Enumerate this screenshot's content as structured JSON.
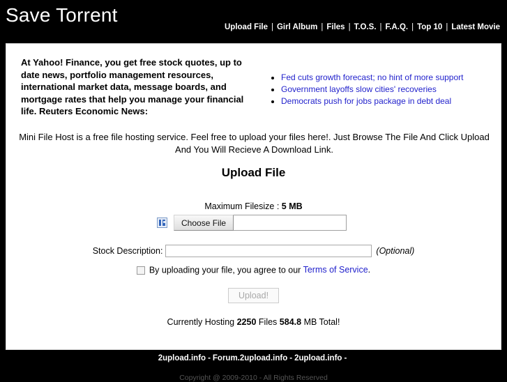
{
  "header": {
    "site_title": "Save Torrent",
    "nav": [
      {
        "label": "Upload File"
      },
      {
        "label": "Girl Album"
      },
      {
        "label": "Files"
      },
      {
        "label": "T.O.S."
      },
      {
        "label": "F.A.Q."
      },
      {
        "label": "Top 10"
      },
      {
        "label": "Latest Movie"
      }
    ],
    "nav_separator": "|"
  },
  "promo": {
    "blurb": "At Yahoo! Finance, you get free stock quotes, up to date news, portfolio management resources, international market data, message boards, and mortgage rates that help you manage your financial life. Reuters Economic News:",
    "news": [
      {
        "label": "Fed cuts growth forecast; no hint of more support"
      },
      {
        "label": "Government layoffs slow cities' recoveries"
      },
      {
        "label": "Democrats push for jobs package in debt deal"
      }
    ]
  },
  "intro": {
    "text": "Mini File Host is a free file hosting service. Feel free to upload your files here!. Just Browse The File And Click Upload And You Will Recieve A Download Link."
  },
  "upload": {
    "heading": "Upload File",
    "max_filesize_label": "Maximum Filesize :",
    "max_filesize_value": "5 MB",
    "choose_file_label": "Choose File",
    "file_name_value": "",
    "description_label": "Stock Description:",
    "description_value": "",
    "description_placeholder": "",
    "optional_note": "(Optional)",
    "terms_text_before": "By uploading your file, you agree to our",
    "terms_link": "Terms of Service",
    "terms_text_after": ".",
    "submit_label": "Upload!"
  },
  "stats": {
    "prefix": "Currently Hosting",
    "file_count": "2250",
    "middle": "Files",
    "total_size": "584.8",
    "suffix": "MB Total!"
  },
  "footer": {
    "links": [
      {
        "label": "2upload.info"
      },
      {
        "label": "Forum.2upload.info"
      },
      {
        "label": "2upload.info"
      }
    ],
    "separator": "-",
    "trailing_separator": "-",
    "copyright": "Copyright @ 2009-2010 - All Rights Reserved"
  },
  "colors": {
    "page_background": "#000000",
    "panel_background": "#ffffff",
    "link": "#2222cc",
    "header_text": "#ffffff",
    "copyright_text": "#555555"
  }
}
